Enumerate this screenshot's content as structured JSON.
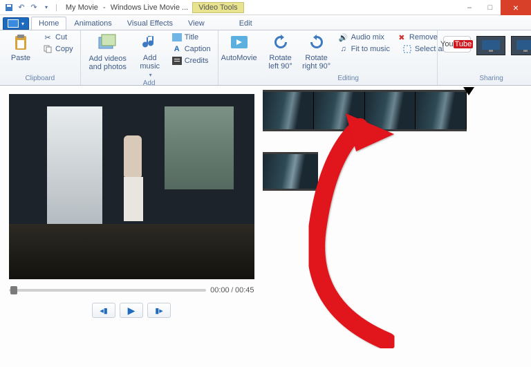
{
  "title": {
    "project": "My Movie",
    "app": "Windows Live Movie ...",
    "context_tab": "Video Tools"
  },
  "tabs": {
    "home": "Home",
    "animations": "Animations",
    "visual_effects": "Visual Effects",
    "view": "View",
    "edit": "Edit"
  },
  "ribbon": {
    "clipboard": {
      "paste": "Paste",
      "cut": "Cut",
      "copy": "Copy",
      "label": "Clipboard"
    },
    "add": {
      "add_videos": "Add videos and photos",
      "add_music": "Add music",
      "title": "Title",
      "caption": "Caption",
      "credits": "Credits",
      "label": "Add"
    },
    "automovie": "AutoMovie",
    "editing": {
      "rotate_left": "Rotate left 90°",
      "rotate_right": "Rotate right 90°",
      "audio_mix": "Audio mix",
      "remove": "Remove",
      "fit_to_music": "Fit to music",
      "select_all": "Select all",
      "label": "Editing"
    },
    "sharing": {
      "youtube": "YouTube",
      "label": "Sharing"
    }
  },
  "player": {
    "time_current": "00:00",
    "time_total": "00:45"
  },
  "window_controls": {
    "minimize": "–",
    "maximize": "□",
    "close": "×"
  }
}
